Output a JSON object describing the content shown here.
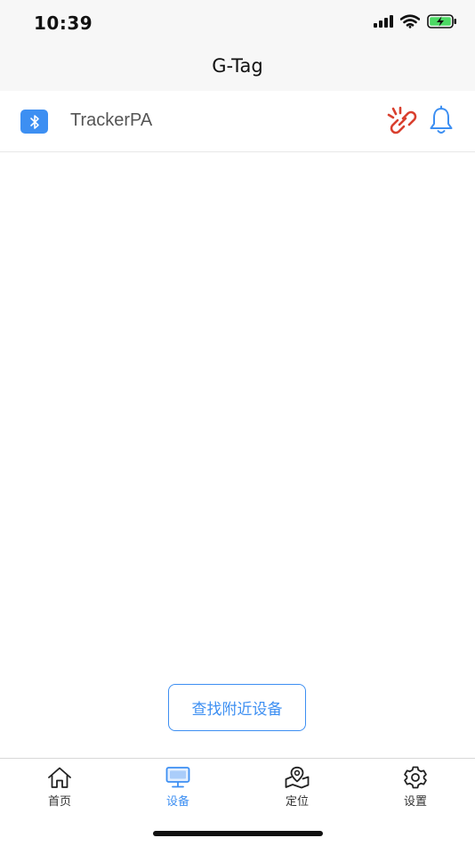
{
  "status_bar": {
    "time": "10:39",
    "icons": [
      "signal-icon",
      "wifi-icon",
      "battery-charging-icon"
    ]
  },
  "nav": {
    "title": "G-Tag"
  },
  "device": {
    "name": "TrackerPA",
    "icons": [
      "bluetooth-icon",
      "link-broken-icon",
      "bell-icon"
    ]
  },
  "actions": {
    "scan_label": "查找附近设备"
  },
  "tabbar": {
    "tabs": [
      {
        "label": "首页",
        "icon": "home-icon",
        "active": false
      },
      {
        "label": "设备",
        "icon": "monitor-icon",
        "active": true
      },
      {
        "label": "定位",
        "icon": "location-map-icon",
        "active": false
      },
      {
        "label": "设置",
        "icon": "gear-icon",
        "active": false
      }
    ]
  },
  "colors": {
    "accent": "#3d8ff2",
    "alert": "#d9402f",
    "topbar_bg": "#f7f7f7",
    "battery_fill": "#4cd964"
  }
}
